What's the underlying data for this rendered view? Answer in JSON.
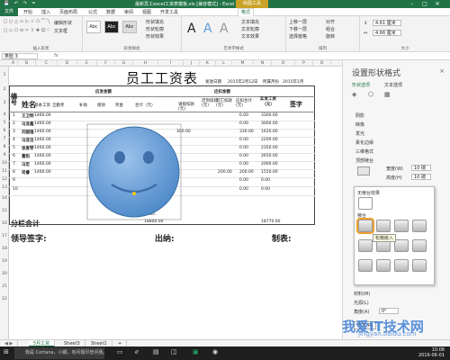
{
  "titlebar": {
    "title": "最新员工excel工资表模板.xls [兼容模式] - Excel",
    "context_tab": "绘图工具",
    "quick_access": "💾 ↶ ↷ ="
  },
  "tabs": [
    "开始",
    "插入",
    "页面布局",
    "公式",
    "数据",
    "审阅",
    "视图",
    "开发工具",
    "格式"
  ],
  "tab_file": "文件",
  "ribbon": {
    "groups": [
      "插入形状",
      "形状样式",
      "艺术字样式",
      "排列",
      "大小"
    ],
    "shape_glyphs": [
      "□",
      "○",
      "△",
      "▭",
      "▷",
      "☆",
      "⬠",
      "⌒",
      "╲",
      "▢",
      "◇",
      "⬡",
      "⬭",
      "⇨",
      "⇧",
      "✚",
      "☺",
      "♡"
    ],
    "edit_shape": "编辑形状",
    "textbox": "文本框",
    "style_labels": [
      "Abc",
      "Abc",
      "Abc"
    ],
    "shape_fill": "形状填充",
    "shape_outline": "形状轮廓",
    "shape_effects": "形状效果",
    "text_fill": "文本填充",
    "text_outline": "文本轮廓",
    "text_effects": "文本效果",
    "arrange": [
      "上移一层",
      "下移一层",
      "选择窗格",
      "对齐",
      "组合",
      "旋转"
    ],
    "height": "4.61 厘米",
    "width": "4.66 厘米"
  },
  "formula": {
    "namebox": "笑脸 3",
    "fx": "fx"
  },
  "columns": [
    "A",
    "B",
    "C",
    "D",
    "E",
    "F",
    "G",
    "H",
    "I",
    "J",
    "K",
    "L",
    "M",
    "N",
    "O",
    "P",
    "Q"
  ],
  "rows": [
    "1",
    "2",
    "3",
    "4",
    "5",
    "6",
    "7",
    "8",
    "9",
    "10",
    "11",
    "12",
    "13",
    "14",
    "15",
    "16",
    "17",
    "18",
    "19",
    "20",
    "21",
    "22"
  ],
  "sheet": {
    "title": "员工工资表",
    "date_label": "发放日期",
    "date_value": "2015年2月12日",
    "period_label": "所属月份",
    "period_value": "2015年1月",
    "h_no": "编号",
    "h_name": "姓名",
    "h_payable": "应发金额",
    "h_deduct": "应扣金额",
    "h_actual": "实发工资（元）",
    "h_sign": "签字",
    "sub_payable": [
      "基本工资",
      "全勤奖",
      "补助",
      "绩效",
      "奖金",
      "合计（元）"
    ],
    "sub_deduct": [
      "请假扣款(元)",
      "迟到扣款(元)",
      "其它扣款(元)",
      "应扣合计(元)"
    ],
    "employees": [
      {
        "no": "1",
        "name": "王卫明",
        "base": "1460.00",
        "total": "",
        "leave": "",
        "other": "",
        "sum": "0.00",
        "actual": "3300.00"
      },
      {
        "no": "2",
        "name": "马亚鑫",
        "base": "1460.00",
        "total": "",
        "leave": "",
        "other": "",
        "sum": "0.00",
        "actual": "3000.00"
      },
      {
        "no": "3",
        "name": "刘国强",
        "base": "1460.00",
        "total": "",
        "leave": "300.00",
        "other": "",
        "sum": "330.00",
        "actual": "1620.00"
      },
      {
        "no": "4",
        "name": "马亚洁",
        "base": "1460.00",
        "total": "",
        "leave": "",
        "other": "",
        "sum": "0.00",
        "actual": "2200.00"
      },
      {
        "no": "5",
        "name": "张爱琴",
        "base": "1460.00",
        "total": "",
        "leave": "",
        "other": "",
        "sum": "0.00",
        "actual": "2350.00"
      },
      {
        "no": "6",
        "name": "葛阳",
        "base": "1460.00",
        "total": "",
        "leave": "",
        "other": "",
        "sum": "0.00",
        "actual": "2650.00"
      },
      {
        "no": "7",
        "name": "马宏",
        "base": "1460.00",
        "total": "",
        "leave": "",
        "other": "",
        "sum": "0.00",
        "actual": "2000.00"
      },
      {
        "no": "8",
        "name": "司睿",
        "base": "1460.00",
        "total": "",
        "leave": "",
        "other": "200.00",
        "sum": "200.00",
        "actual": "1550.00"
      }
    ],
    "blank_rows": [
      {
        "no": "9",
        "sum": "0.00",
        "actual": "0.00"
      },
      {
        "no": "10",
        "sum": "0.00",
        "actual": "0.00"
      }
    ],
    "subtotal_label": "分栏合计",
    "subtotal_pay": "18800.00",
    "subtotal_actual": "18770.00",
    "partial_value": "0.00",
    "leader_sign": "领导签字:",
    "cashier": "出纳:",
    "preparer": "制表:"
  },
  "pane": {
    "title": "设置形状格式",
    "tab1": "形状选项",
    "tab2": "文本选项",
    "items": [
      "阴影",
      "映像",
      "发光",
      "柔化边缘",
      "三维格式"
    ],
    "top_bevel": "顶部棱台",
    "width_label": "宽度(W)",
    "width_value": "10 磅",
    "height_label": "高度(H)",
    "height_value": "10 磅",
    "no_bevel": "无棱台效果",
    "bevel_label": "棱台",
    "bevel_tooltip": "松散嵌入",
    "material": "材料(M)",
    "lighting": "光源(L)",
    "angle": "角度(A)",
    "reset": "重置(R)",
    "close": "×"
  },
  "sheettabs": [
    "5月工资",
    "Sheet3",
    "Sheet1",
    "+"
  ],
  "taskbar": {
    "search": "我是 Cortana，小娜，有问题尽管问我。",
    "time": "10:08",
    "date": "2016-06-01"
  },
  "watermark": {
    "text": "我爱IT技术网",
    "url": "jingyan.baidu.com"
  },
  "colors": {
    "excel_green": "#217346",
    "context_gold": "#c9a227",
    "shape_blue": "#5b9bd5"
  }
}
